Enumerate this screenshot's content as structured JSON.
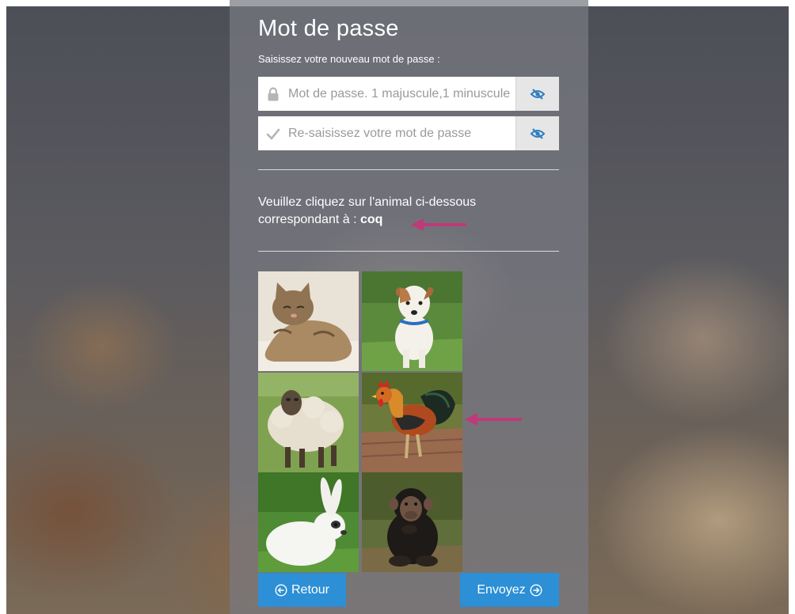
{
  "page": {
    "title": "Mot de passe",
    "subtitle": "Saisissez votre nouveau mot de passe :"
  },
  "password_field": {
    "placeholder": "Mot de passe. 1 majuscule,1 minuscule",
    "value": "",
    "icon": "lock-icon",
    "toggle_icon": "eye-slash-icon"
  },
  "confirm_field": {
    "placeholder": "Re-saisissez votre mot de passe",
    "value": "",
    "icon": "check-icon",
    "toggle_icon": "eye-slash-icon"
  },
  "captcha": {
    "instruction": "Veuillez cliquez sur l'animal ci-dessous correspondant à :",
    "target_animal": "coq",
    "tiles": [
      "cat",
      "dog",
      "sheep",
      "rooster",
      "rabbit",
      "chimpanzee"
    ]
  },
  "buttons": {
    "back_label": "Retour",
    "back_icon": "arrow-left-circle-icon",
    "submit_label": "Envoyez",
    "submit_icon": "arrow-right-circle-icon"
  },
  "colors": {
    "accent": "#2d8fd5",
    "annotation_arrow": "#c0397a",
    "eye_icon": "#2d7fc0"
  }
}
